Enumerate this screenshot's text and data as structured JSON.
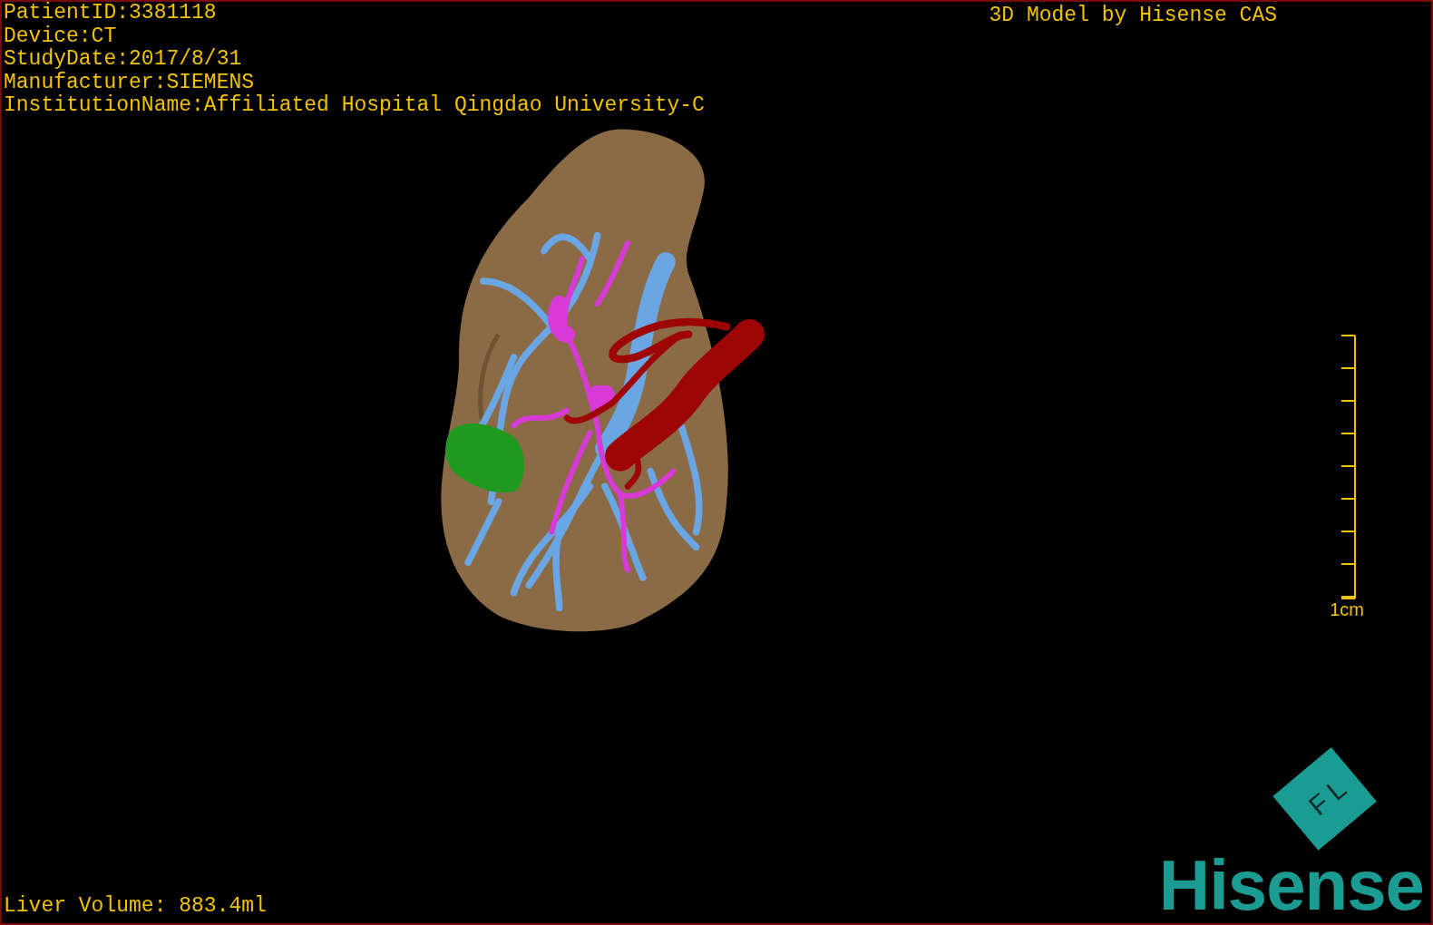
{
  "info_lines": [
    "PatientID:3381118",
    "Device:CT",
    "StudyDate:2017/8/31",
    "Manufacturer:SIEMENS",
    "InstitutionName:Affiliated Hospital Qingdao University-C"
  ],
  "title": "3D Model by Hisense CAS",
  "scale": {
    "label": "1cm"
  },
  "volume": "Liver Volume: 883.4ml",
  "logo": {
    "cube_labels": [
      "F",
      "L"
    ],
    "brand": "Hisense"
  }
}
